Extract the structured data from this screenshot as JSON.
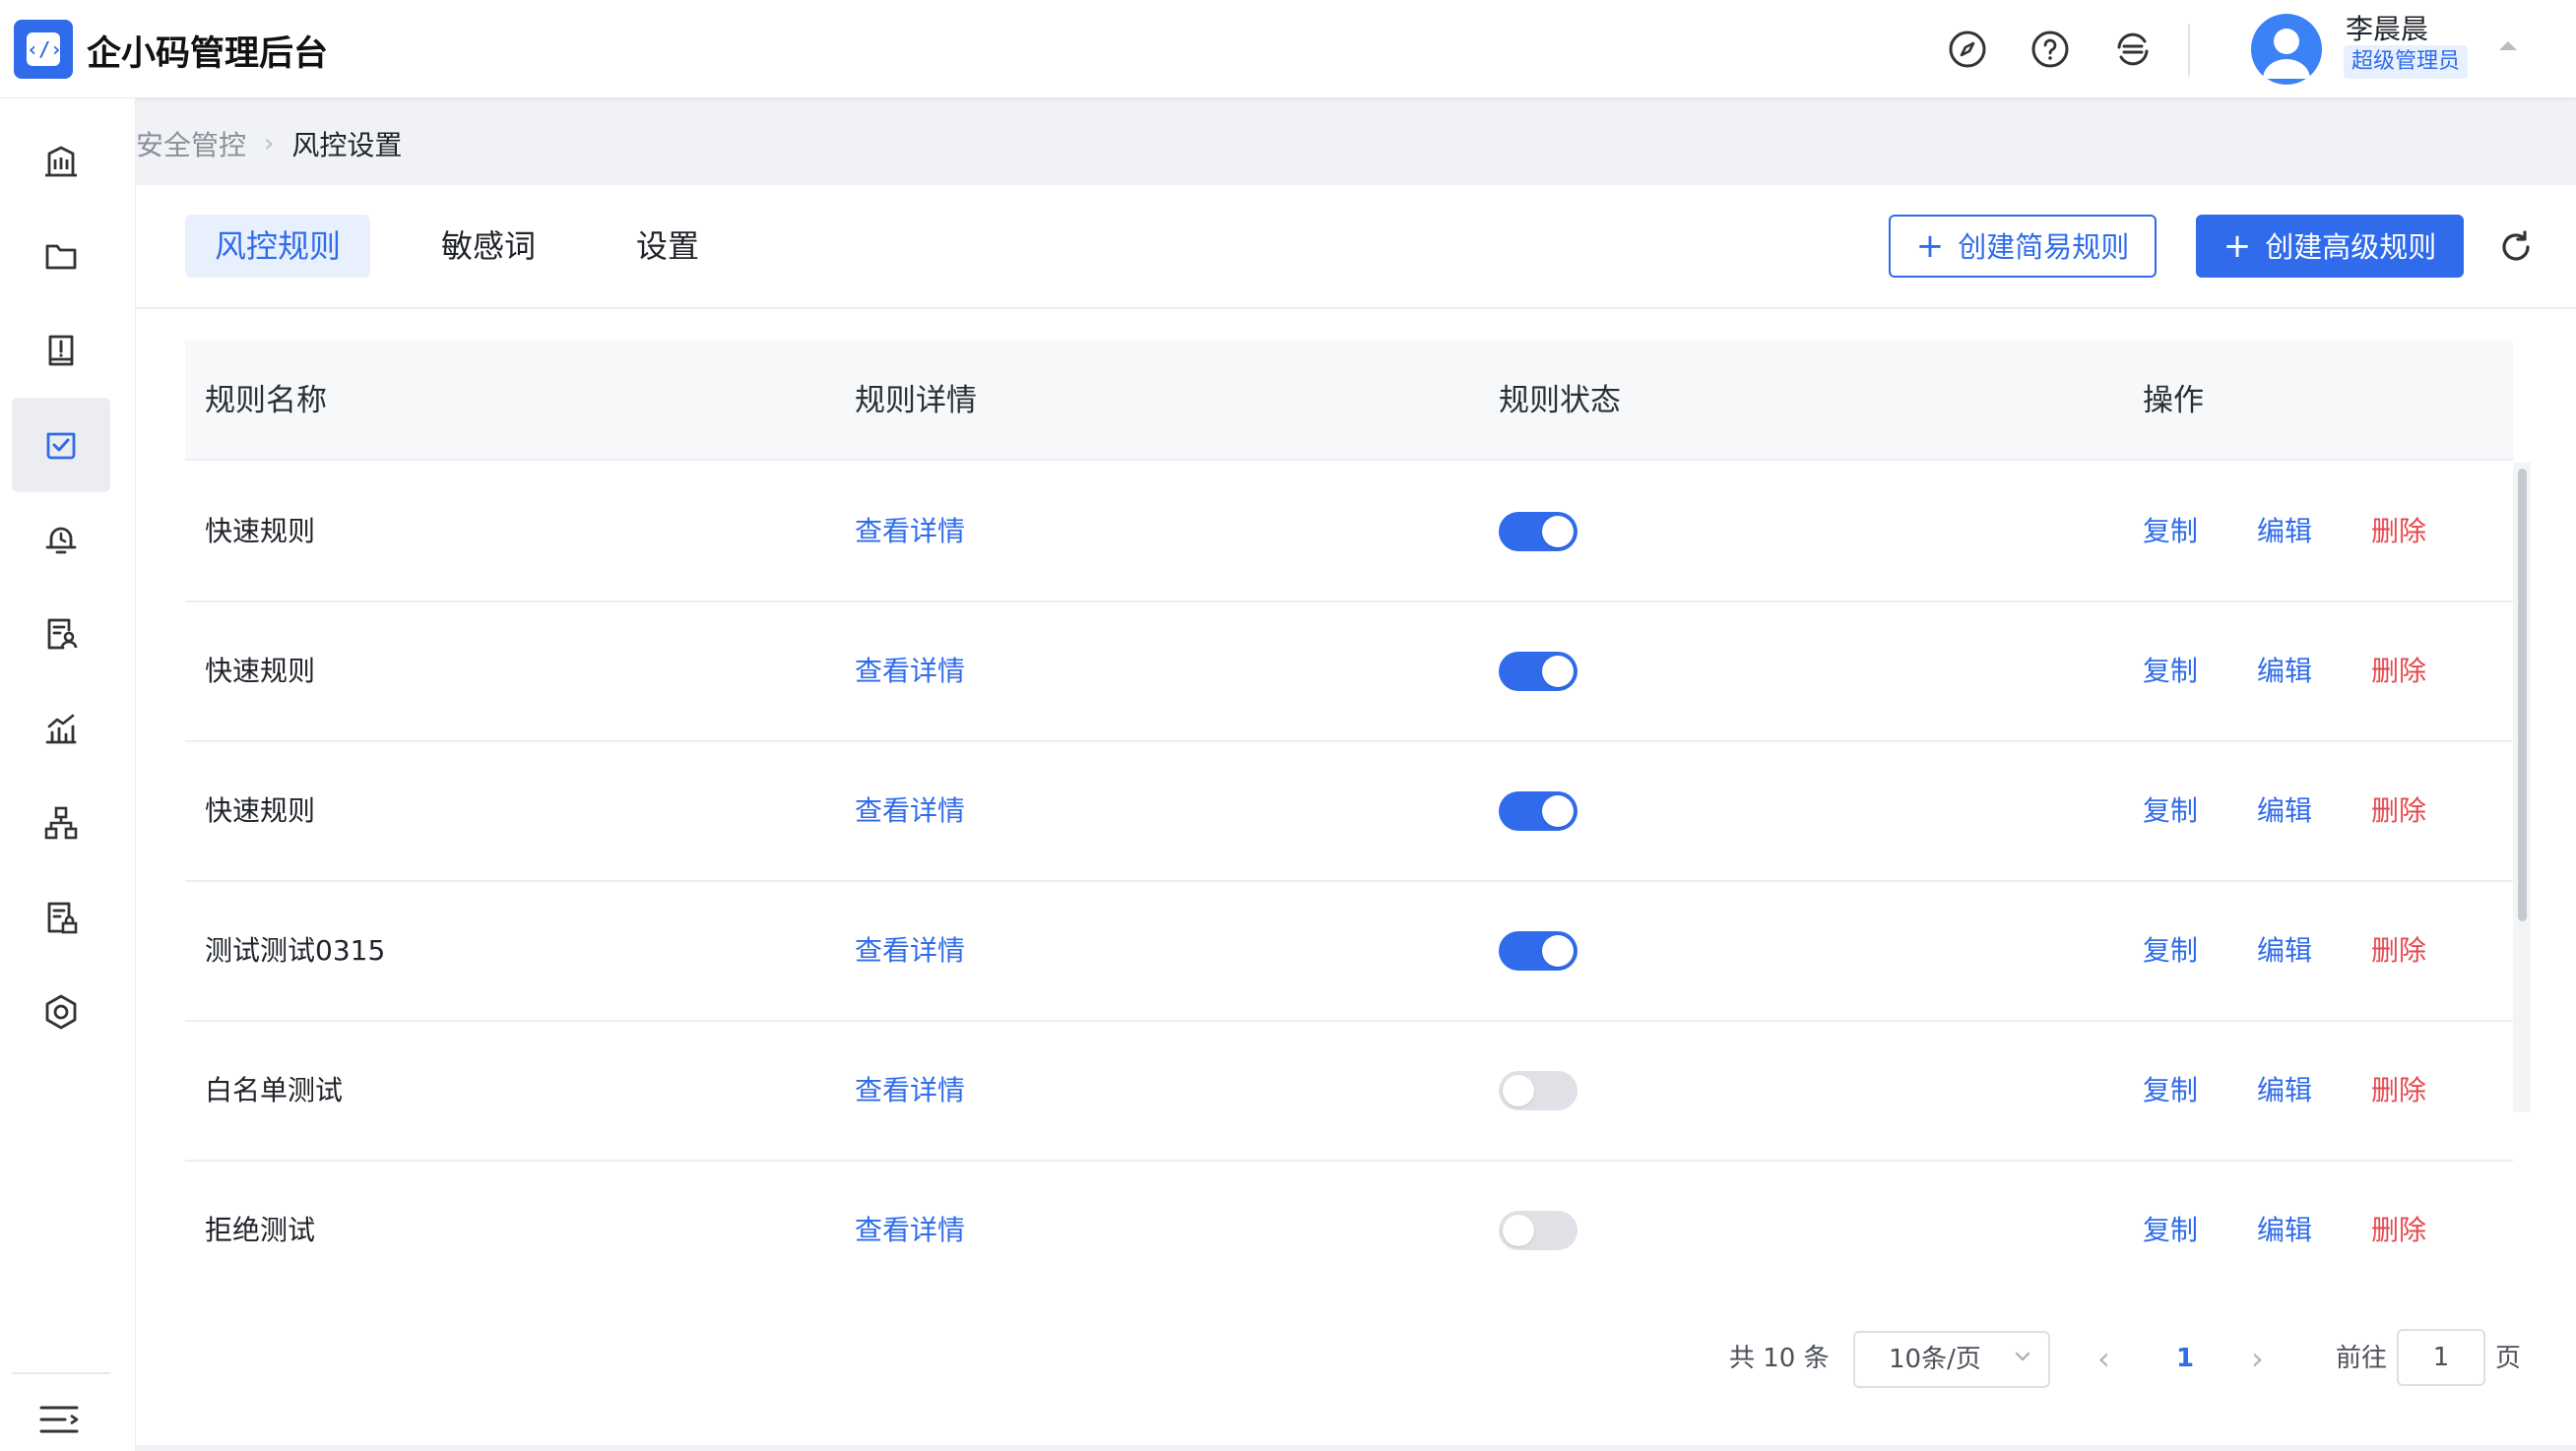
{
  "app": {
    "title": "企小码管理后台",
    "logo_glyph": "‹/›"
  },
  "header": {
    "icons": [
      "compass-icon",
      "help-icon",
      "switch-icon"
    ],
    "user": {
      "name": "李晨晨",
      "role": "超级管理员"
    }
  },
  "sidebar": {
    "items": [
      {
        "name": "building-icon",
        "active": false
      },
      {
        "name": "folder-icon",
        "active": false
      },
      {
        "name": "book-icon",
        "active": false
      },
      {
        "name": "shield-check-icon",
        "active": true
      },
      {
        "name": "alarm-icon",
        "active": false
      },
      {
        "name": "document-user-icon",
        "active": false
      },
      {
        "name": "chart-icon",
        "active": false
      },
      {
        "name": "org-icon",
        "active": false
      },
      {
        "name": "file-lock-icon",
        "active": false
      },
      {
        "name": "hexagon-icon",
        "active": false
      }
    ]
  },
  "breadcrumb": {
    "parent": "安全管控",
    "current": "风控设置"
  },
  "tabs": [
    {
      "label": "风控规则",
      "active": true
    },
    {
      "label": "敏感词",
      "active": false
    },
    {
      "label": "设置",
      "active": false
    }
  ],
  "actions": {
    "create_simple": "创建简易规则",
    "create_advanced": "创建高级规则",
    "plus": "+"
  },
  "table": {
    "headers": {
      "name": "规则名称",
      "detail": "规则详情",
      "status": "规则状态",
      "ops": "操作"
    },
    "rows": [
      {
        "name": "快速规则",
        "detail": "查看详情",
        "enabled": true
      },
      {
        "name": "快速规则",
        "detail": "查看详情",
        "enabled": true
      },
      {
        "name": "快速规则",
        "detail": "查看详情",
        "enabled": true
      },
      {
        "name": "测试测试0315",
        "detail": "查看详情",
        "enabled": true
      },
      {
        "name": "白名单测试",
        "detail": "查看详情",
        "enabled": false
      },
      {
        "name": "拒绝测试",
        "detail": "查看详情",
        "enabled": false
      }
    ],
    "op_labels": {
      "copy": "复制",
      "edit": "编辑",
      "delete": "删除"
    }
  },
  "pagination": {
    "total": "共 10 条",
    "page_size": "10条/页",
    "prev": "‹",
    "current": "1",
    "next": "›",
    "goto_label": "前往",
    "goto_value": "1",
    "page_suffix": "页"
  },
  "colors": {
    "accent": "#2f6bea",
    "danger": "#e5484d",
    "toggle_off": "#dfe1e6"
  }
}
